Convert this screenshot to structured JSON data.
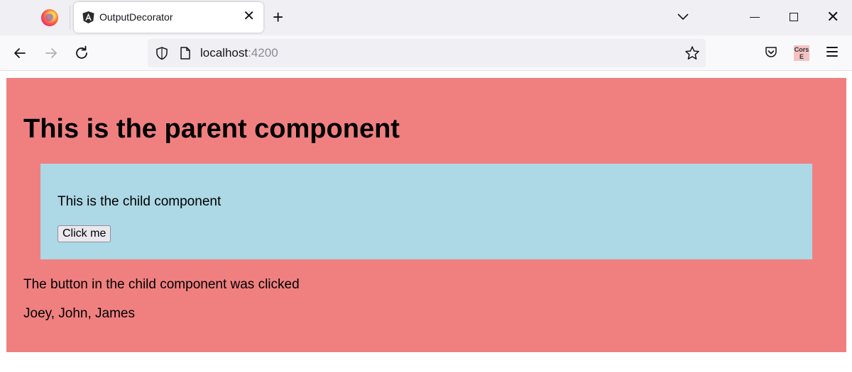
{
  "browser": {
    "tab": {
      "title": "OutputDecorator",
      "close": "✕"
    },
    "new_tab": "+",
    "window_close": "✕",
    "url": {
      "host": "localhost",
      "port": ":4200"
    },
    "extension_label": "Cors E"
  },
  "page": {
    "parent_title": "This is the parent component",
    "child_text": "This is the child component",
    "button_label": "Click me",
    "message": "The button in the child component was clicked",
    "names": "Joey, John, James"
  },
  "colors": {
    "parent_bg": "#f08080",
    "child_bg": "#add8e6"
  }
}
